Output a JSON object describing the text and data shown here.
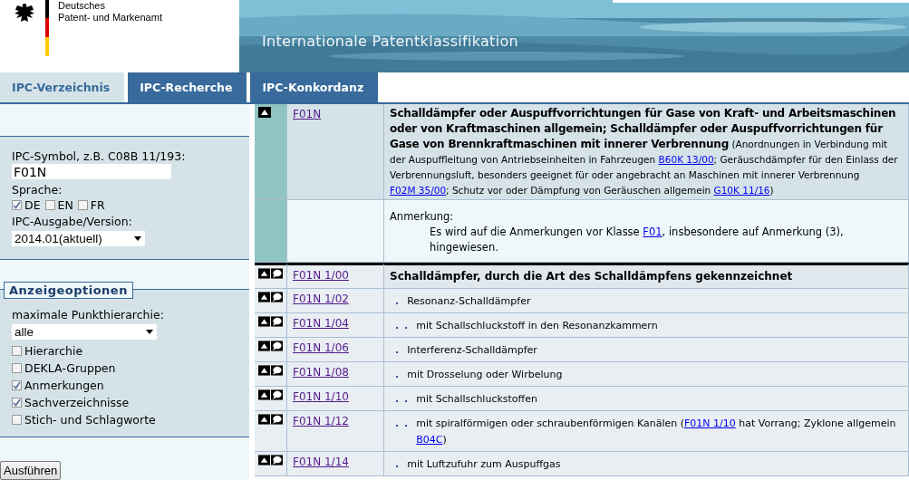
{
  "header": {
    "org_line_1": "Deutsches",
    "org_line_2": "Patent- und Markenamt",
    "title": "Internationale Patentklassifikation"
  },
  "nav": [
    {
      "label": "IPC-Verzeichnis",
      "selected": true
    },
    {
      "label": "IPC-Recherche",
      "selected": false
    },
    {
      "label": "IPC-Konkordanz",
      "selected": false
    }
  ],
  "search": {
    "symbol_label": "IPC-Symbol, z.B. C08B 11/193:",
    "symbol_value": "F01N",
    "language_label": "Sprache:",
    "languages": [
      {
        "label": "DE",
        "checked": true
      },
      {
        "label": "EN",
        "checked": false
      },
      {
        "label": "FR",
        "checked": false
      }
    ],
    "version_label": "IPC-Ausgabe/Version:",
    "version_value": "2014.01(aktuell)"
  },
  "display_options": {
    "legend": "Anzeigeoptionen",
    "hierarchy_label": "maximale Punkthierarchie:",
    "hierarchy_value": "alle",
    "options": [
      {
        "label": "Hierarchie",
        "checked": false
      },
      {
        "label": "DEKLA-Gruppen",
        "checked": false
      },
      {
        "label": "Anmerkungen",
        "checked": true
      },
      {
        "label": "Sachverzeichnisse",
        "checked": true
      },
      {
        "label": "Stich- und Schlagworte",
        "checked": false
      }
    ]
  },
  "submit": "Ausführen",
  "entries": [
    {
      "kind": "class",
      "symbol": "F01N",
      "segments": [
        {
          "kind": "bold",
          "text": "Schalldämpfer oder Auspuffvorrichtungen für Gase von Kraft- und Arbeitsmaschinen oder von Kraftmaschinen allgemein; Schalldämpfer oder Auspuffvorrichtungen für Gase von Brennkraftmaschinen mit innerer Verbrennung"
        },
        {
          "kind": "text",
          "text": " (Anordnungen in Verbindung mit der Auspuffleitung von Antriebseinheiten in Fahrzeugen "
        },
        {
          "kind": "link",
          "text": "B60K 13/00"
        },
        {
          "kind": "text",
          "text": ";  Geräuschdämpfer für den Einlass der Verbrennungsluft, besonders geeignet für oder angebracht an Maschinen mit innerer Verbrennung "
        },
        {
          "kind": "link",
          "text": "F02M 35/00"
        },
        {
          "kind": "text",
          "text": ";  Schutz vor oder Dämpfung von Geräuschen allgemein "
        },
        {
          "kind": "link",
          "text": "G10K 11/16"
        },
        {
          "kind": "text",
          "text": ")"
        }
      ]
    },
    {
      "kind": "note",
      "title": "Anmerkung:",
      "segments": [
        {
          "kind": "text",
          "text": "Es wird auf die Anmerkungen vor Klasse "
        },
        {
          "kind": "link",
          "text": "F01"
        },
        {
          "kind": "text",
          "text": ", insbesondere auf Anmerkung (3), hingewiesen."
        }
      ]
    },
    {
      "kind": "main",
      "symbol": "F01N 1/00",
      "segments": [
        {
          "kind": "bold",
          "text": "Schalldämpfer, durch die Art des Schalldämpfens gekennzeichnet"
        }
      ]
    },
    {
      "kind": "group",
      "symbol": "F01N 1/02",
      "dots": ".",
      "segments": [
        {
          "kind": "text",
          "text": "Resonanz-Schalldämpfer"
        }
      ]
    },
    {
      "kind": "group",
      "symbol": "F01N 1/04",
      "dots": ". .",
      "segments": [
        {
          "kind": "text",
          "text": "mit Schallschluckstoff in den Resonanzkammern"
        }
      ]
    },
    {
      "kind": "group",
      "symbol": "F01N 1/06",
      "dots": ".",
      "segments": [
        {
          "kind": "text",
          "text": "Interferenz-Schalldämpfer"
        }
      ]
    },
    {
      "kind": "group",
      "symbol": "F01N 1/08",
      "dots": ".",
      "segments": [
        {
          "kind": "text",
          "text": "mit Drosselung oder Wirbelung"
        }
      ]
    },
    {
      "kind": "group",
      "symbol": "F01N 1/10",
      "dots": ". .",
      "segments": [
        {
          "kind": "text",
          "text": "mit Schallschluckstoffen"
        }
      ]
    },
    {
      "kind": "group",
      "symbol": "F01N 1/12",
      "dots": ". .",
      "segments": [
        {
          "kind": "text",
          "text": "mit spiralförmigen oder schraubenförmigen Kanälen  ("
        },
        {
          "kind": "link",
          "text": "F01N 1/10"
        },
        {
          "kind": "text",
          "text": " hat Vorrang;  Zyklone allgemein "
        },
        {
          "kind": "link",
          "text": "B04C"
        },
        {
          "kind": "text",
          "text": ")"
        }
      ]
    },
    {
      "kind": "group",
      "symbol": "F01N 1/14",
      "dots": ".",
      "segments": [
        {
          "kind": "text",
          "text": "mit Luftzufuhr zum Auspuffgas"
        }
      ]
    }
  ]
}
